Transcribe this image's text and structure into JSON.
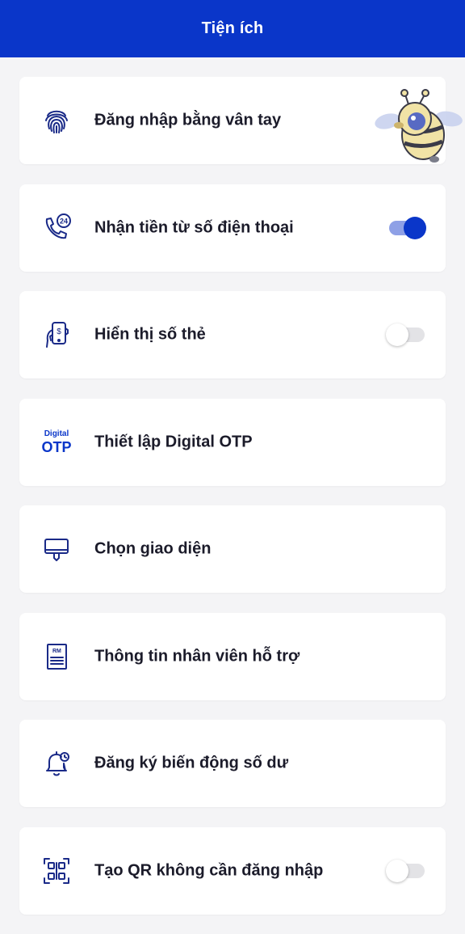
{
  "header": {
    "title": "Tiện ích"
  },
  "colors": {
    "brand": "#0a36c9",
    "icon": "#1a2a88",
    "toggle_off_track": "#e3e3e6"
  },
  "items": [
    {
      "label": "Đăng nhập bằng vân tay",
      "icon": "fingerprint-icon",
      "toggle": null
    },
    {
      "label": "Nhận tiền từ số điện thoại",
      "icon": "phone-24-icon",
      "toggle": "on"
    },
    {
      "label": "Hiển thị số thẻ",
      "icon": "hand-card-icon",
      "toggle": "off"
    },
    {
      "label": "Thiết lập Digital OTP",
      "icon": "digital-otp-icon",
      "toggle": null,
      "icon_text_small": "Digital",
      "icon_text_big": "OTP"
    },
    {
      "label": "Chọn giao diện",
      "icon": "paint-roller-icon",
      "toggle": null
    },
    {
      "label": "Thông tin nhân viên hỗ trợ",
      "icon": "rm-document-icon",
      "toggle": null,
      "icon_text": "RM"
    },
    {
      "label": "Đăng ký biến động số dư",
      "icon": "bell-clock-icon",
      "toggle": null
    },
    {
      "label": "Tạo QR không cần đăng nhập",
      "icon": "qr-scan-icon",
      "toggle": "off"
    }
  ]
}
